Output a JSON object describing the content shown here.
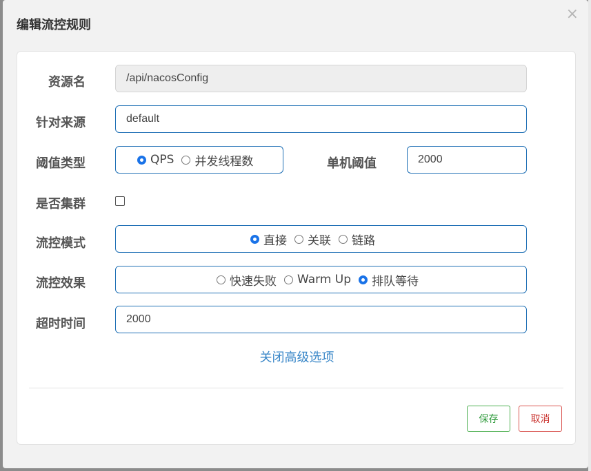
{
  "dialog": {
    "title": "编辑流控规则",
    "close_icon": "×"
  },
  "form": {
    "resource": {
      "label": "资源名",
      "value": "/api/nacosConfig"
    },
    "limit_app": {
      "label": "针对来源",
      "value": "default"
    },
    "threshold_type": {
      "label": "阈值类型",
      "options": [
        "QPS",
        "并发线程数"
      ],
      "selected": "QPS"
    },
    "threshold": {
      "label": "单机阈值",
      "value": "2000"
    },
    "cluster": {
      "label": "是否集群",
      "checked": false
    },
    "strategy": {
      "label": "流控模式",
      "options": [
        "直接",
        "关联",
        "链路"
      ],
      "selected": "直接"
    },
    "control_behavior": {
      "label": "流控效果",
      "options": [
        "快速失败",
        "Warm Up",
        "排队等待"
      ],
      "selected": "排队等待"
    },
    "timeout": {
      "label": "超时时间",
      "value": "2000"
    }
  },
  "advanced_toggle": "关闭高级选项",
  "buttons": {
    "save": "保存",
    "cancel": "取消"
  },
  "colors": {
    "accent": "#1e6fb5",
    "save": "#4caf50",
    "cancel": "#d9534f",
    "link": "#3a87c8"
  }
}
